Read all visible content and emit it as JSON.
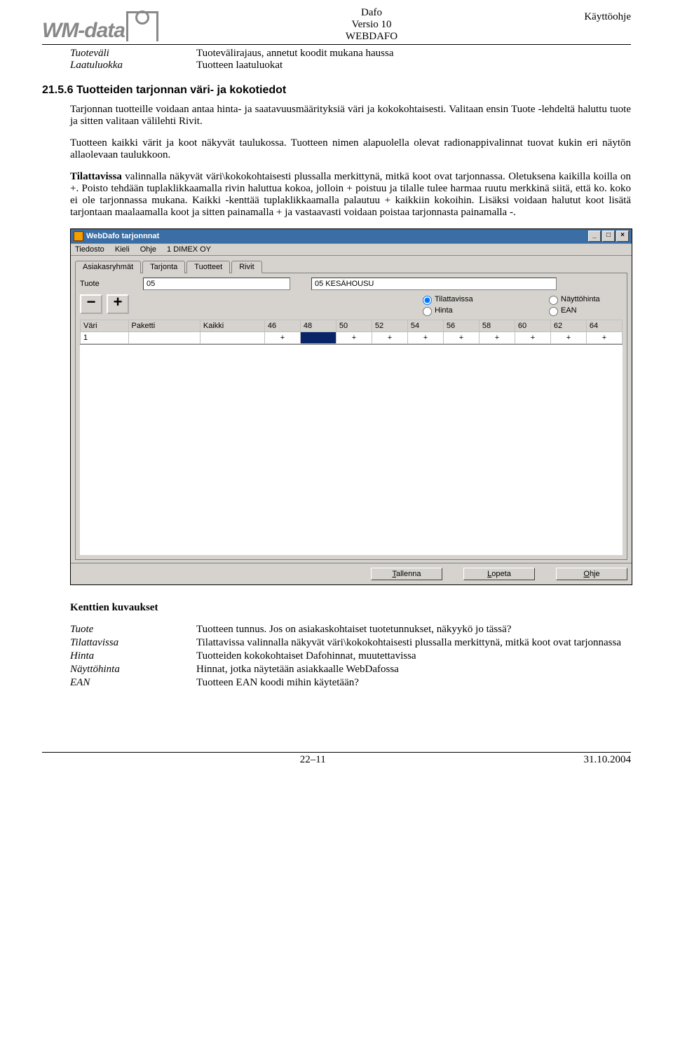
{
  "header": {
    "logo_text": "WM-data",
    "title": "Dafo",
    "version": "Versio 10",
    "system": "WEBDAFO",
    "right": "Käyttöohje"
  },
  "defs": [
    {
      "term": "Tuoteväli",
      "desc": "Tuotevälirajaus, annetut koodit mukana haussa"
    },
    {
      "term": "Laatuluokka",
      "desc": "Tuotteen laatuluokat"
    }
  ],
  "section": {
    "num": "21.5.6",
    "title": "Tuotteiden tarjonnan väri- ja kokotiedot"
  },
  "para1": "Tarjonnan tuotteille voidaan antaa hinta- ja saatavuusmäärityksiä väri ja kokokohtaisesti. Valitaan ensin Tuote -lehdeltä haluttu tuote ja sitten valitaan välilehti Rivit.",
  "para2": "Tuotteen kaikki värit ja koot näkyvät taulukossa. Tuotteen nimen alapuolella olevat radionappivalinnat tuovat kukin eri näytön allaolevaan taulukkoon.",
  "para3_bold": "Tilattavissa",
  "para3": " valinnalla näkyvät väri\\kokokohtaisesti plussalla merkittynä, mitkä koot ovat tarjonnassa. Oletuksena kaikilla koilla on +. Poisto tehdään tuplaklikkaamalla rivin haluttua kokoa, jolloin + poistuu ja tilalle tulee harmaa ruutu merkkinä siitä, että ko. koko ei ole tarjonnassa mukana. Kaikki -kenttää tuplaklikkaamalla palautuu + kaikkiin kokoihin. Lisäksi voidaan halutut koot lisätä tarjontaan maalaamalla koot ja sitten painamalla + ja vastaavasti voidaan poistaa tarjonnasta painamalla -.",
  "window": {
    "title": "WebDafo tarjonnnat",
    "menus": [
      "Tiedosto",
      "Kieli",
      "Ohje",
      "1 DIMEX OY"
    ],
    "tabs": [
      "Asiakasryhmät",
      "Tarjonta",
      "Tuotteet",
      "Rivit"
    ],
    "active_tab": 3,
    "tuote_label": "Tuote",
    "tuote_value": "05",
    "tuote_name": "05 KESÄHOUSU",
    "radios": {
      "tilattavissa": "Tilattavissa",
      "hinta": "Hinta",
      "nayttohinta": "Näyttöhinta",
      "ean": "EAN"
    },
    "minus": "−",
    "plus": "+",
    "grid_headers": [
      "Väri",
      "Paketti",
      "Kaikki",
      "46",
      "48",
      "50",
      "52",
      "54",
      "56",
      "58",
      "60",
      "62",
      "64"
    ],
    "grid_row": [
      "1",
      "",
      "",
      "+",
      "",
      "+",
      "+",
      "+",
      "+",
      "+",
      "+",
      "+",
      "+"
    ],
    "buttons": {
      "tallenna": "Tallenna",
      "lopeta": "Lopeta",
      "ohje": "Ohje"
    }
  },
  "fields_title": "Kenttien kuvaukset",
  "fields": [
    {
      "term": "Tuote",
      "desc": "Tuotteen tunnus. Jos on asiakaskohtaiset tuotetunnukset, näkyykö jo tässä?"
    },
    {
      "term": "Tilattavissa",
      "desc": "Tilattavissa valinnalla näkyvät väri\\kokokohtaisesti plussalla merkittynä, mitkä koot ovat tarjonnassa"
    },
    {
      "term": "Hinta",
      "desc": "Tuotteiden kokokohtaiset Dafohinnat, muutettavissa"
    },
    {
      "term": "Näyttöhinta",
      "desc": "Hinnat, jotka näytetään asiakkaalle WebDafossa"
    },
    {
      "term": "EAN",
      "desc": "Tuotteen EAN koodi mihin käytetään?"
    }
  ],
  "footer": {
    "page": "22–11",
    "date": "31.10.2004"
  }
}
